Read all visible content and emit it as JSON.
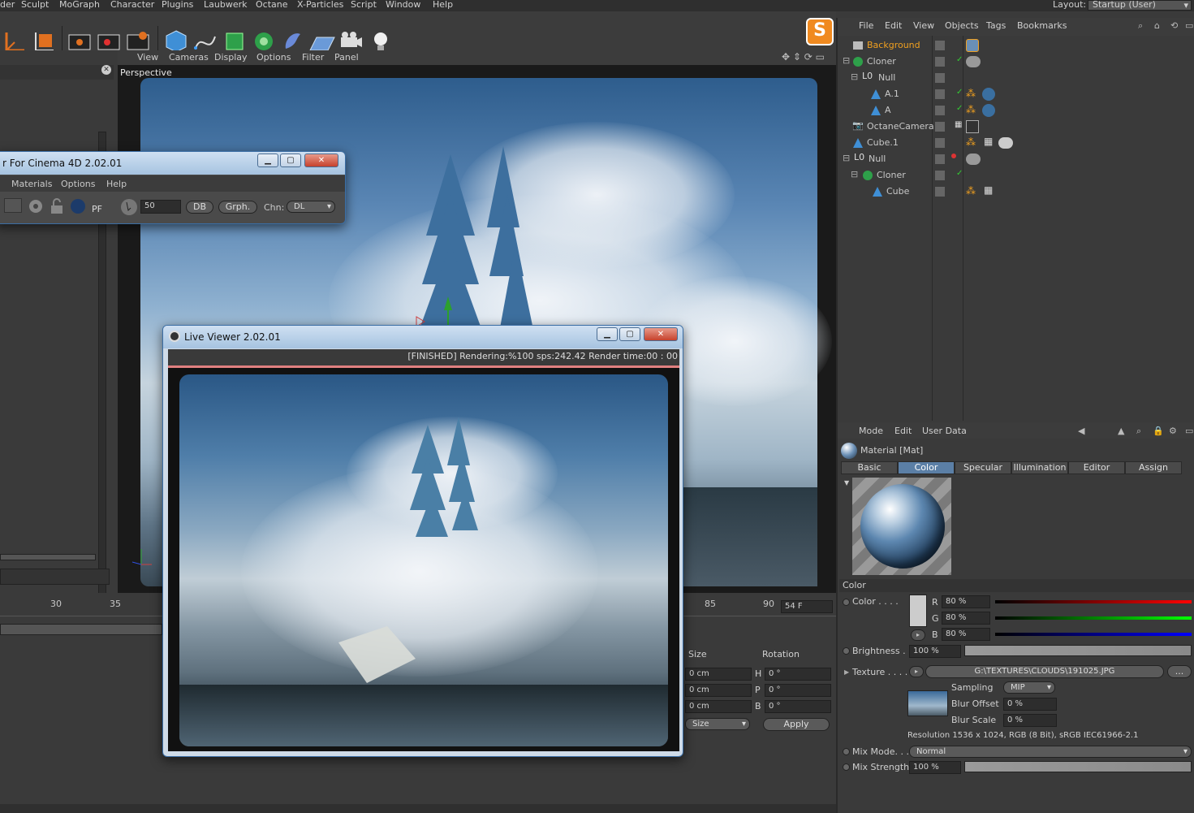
{
  "menubar": {
    "items": [
      "der",
      "Sculpt",
      "MoGraph",
      "Character",
      "Plugins",
      "Laubwerk",
      "Octane",
      "X-Particles",
      "Script",
      "Window",
      "Help"
    ],
    "layout_label": "Layout:",
    "layout_value": "Startup (User)"
  },
  "viewport": {
    "menu": [
      "View",
      "Cameras",
      "Display",
      "Options",
      "Filter",
      "Panel"
    ],
    "label": "Perspective"
  },
  "plugin_window": {
    "title": "r For Cinema 4D 2.02.01",
    "menu": [
      "Materials",
      "Options",
      "Help"
    ],
    "value_field": "50",
    "btn_db": "DB",
    "btn_grph": "Grph.",
    "chn_label": "Chn:",
    "chn_value": "DL"
  },
  "live_viewer": {
    "title": "Live Viewer 2.02.01",
    "status": "[FINISHED]  Rendering:%100 sps:242.42 Render time:00 : 00"
  },
  "timeline": {
    "ticks": [
      "30",
      "35",
      "85",
      "90"
    ],
    "frame_field": "54 F"
  },
  "coords": {
    "col_size": "Size",
    "col_rotation": "Rotation",
    "rows": [
      {
        "size": "0 cm",
        "rot_label": "H",
        "rot": "0 °"
      },
      {
        "size": "0 cm",
        "rot_label": "P",
        "rot": "0 °"
      },
      {
        "size": "0 cm",
        "rot_label": "B",
        "rot": "0 °"
      }
    ],
    "mode_dd": "Size",
    "apply": "Apply"
  },
  "object_manager": {
    "menu": [
      "File",
      "Edit",
      "View",
      "Objects",
      "Tags",
      "Bookmarks"
    ],
    "objects": [
      {
        "name": "Background",
        "color": "#f0a020"
      },
      {
        "name": "Cloner",
        "color": "#d0d0d0"
      },
      {
        "name": "Null",
        "color": "#d0d0d0"
      },
      {
        "name": "A.1",
        "color": "#d0d0d0"
      },
      {
        "name": "A",
        "color": "#d0d0d0"
      },
      {
        "name": "OctaneCamera",
        "color": "#d0d0d0"
      },
      {
        "name": "Cube.1",
        "color": "#d0d0d0"
      },
      {
        "name": "Null",
        "color": "#d0d0d0"
      },
      {
        "name": "Cloner",
        "color": "#d0d0d0"
      },
      {
        "name": "Cube",
        "color": "#d0d0d0"
      }
    ]
  },
  "attributes": {
    "menu": [
      "Mode",
      "Edit",
      "User Data"
    ],
    "material_title": "Material [Mat]",
    "tabs": [
      "Basic",
      "Color",
      "Specular",
      "Illumination",
      "Editor",
      "Assign"
    ],
    "active_tab": "Color",
    "section": "Color",
    "color_label": "Color . . . .",
    "r_label": "R",
    "r_value": "80 %",
    "g_label": "G",
    "g_value": "80 %",
    "b_label": "B",
    "b_value": "80 %",
    "brightness_label": "Brightness .",
    "brightness_value": "100 %",
    "texture_label": "Texture . . . . .",
    "texture_path": "G:\\TEXTURES\\CLOUDS\\191025.JPG",
    "texture_more": "...",
    "sampling_label": "Sampling",
    "sampling_value": "MIP",
    "blur_offset_label": "Blur Offset",
    "blur_offset_value": "0 %",
    "blur_scale_label": "Blur Scale",
    "blur_scale_value": "0 %",
    "resolution": "Resolution 1536 x 1024, RGB (8 Bit), sRGB IEC61966-2.1",
    "mixmode_label": "Mix Mode. . . .",
    "mixmode_value": "Normal",
    "mixstrength_label": "Mix Strength",
    "mixstrength_value": "100 %"
  },
  "colors": {
    "accent": "#5b7fa6",
    "highlight": "#f0a020",
    "bg": "#3a3a3a"
  }
}
